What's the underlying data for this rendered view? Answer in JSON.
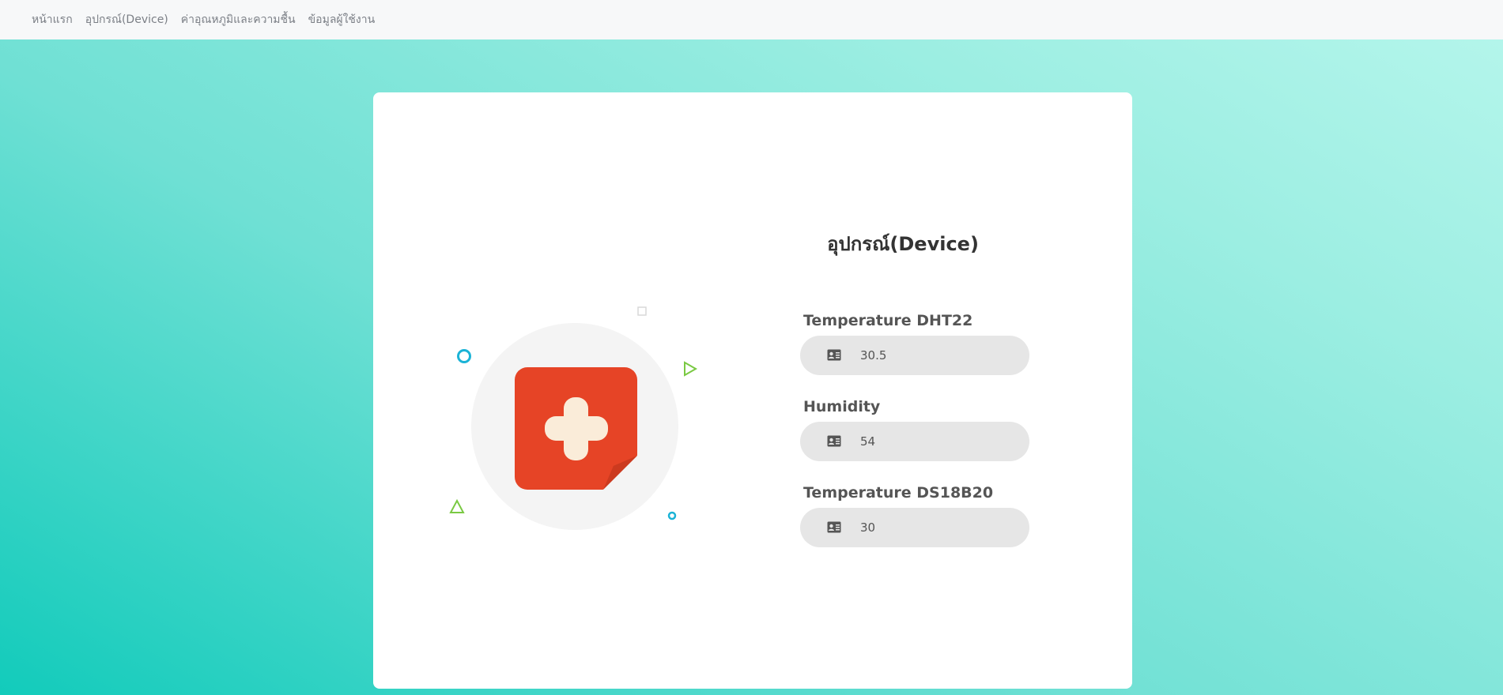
{
  "nav": {
    "items": [
      {
        "label": "หน้าแรก"
      },
      {
        "label": "อุปกรณ์(Device)"
      },
      {
        "label": "ค่าอุณหภูมิและความชื้น"
      },
      {
        "label": "ข้อมูลผู้ใช้งาน"
      }
    ]
  },
  "card": {
    "title": "อุปกรณ์(Device)",
    "fields": [
      {
        "label": "Temperature DHT22",
        "value": "30.5",
        "icon": "id-card-icon"
      },
      {
        "label": "Humidity",
        "value": "54",
        "icon": "id-card-icon"
      },
      {
        "label": "Temperature DS18B20",
        "value": "30",
        "icon": "id-card-icon"
      }
    ]
  },
  "colors": {
    "accent_red": "#e64426",
    "cross": "#faecd9",
    "deco_blue": "#1bb3d6",
    "deco_green": "#7ac943",
    "background_start": "#12cbbb",
    "background_end": "#b6f6ec"
  }
}
